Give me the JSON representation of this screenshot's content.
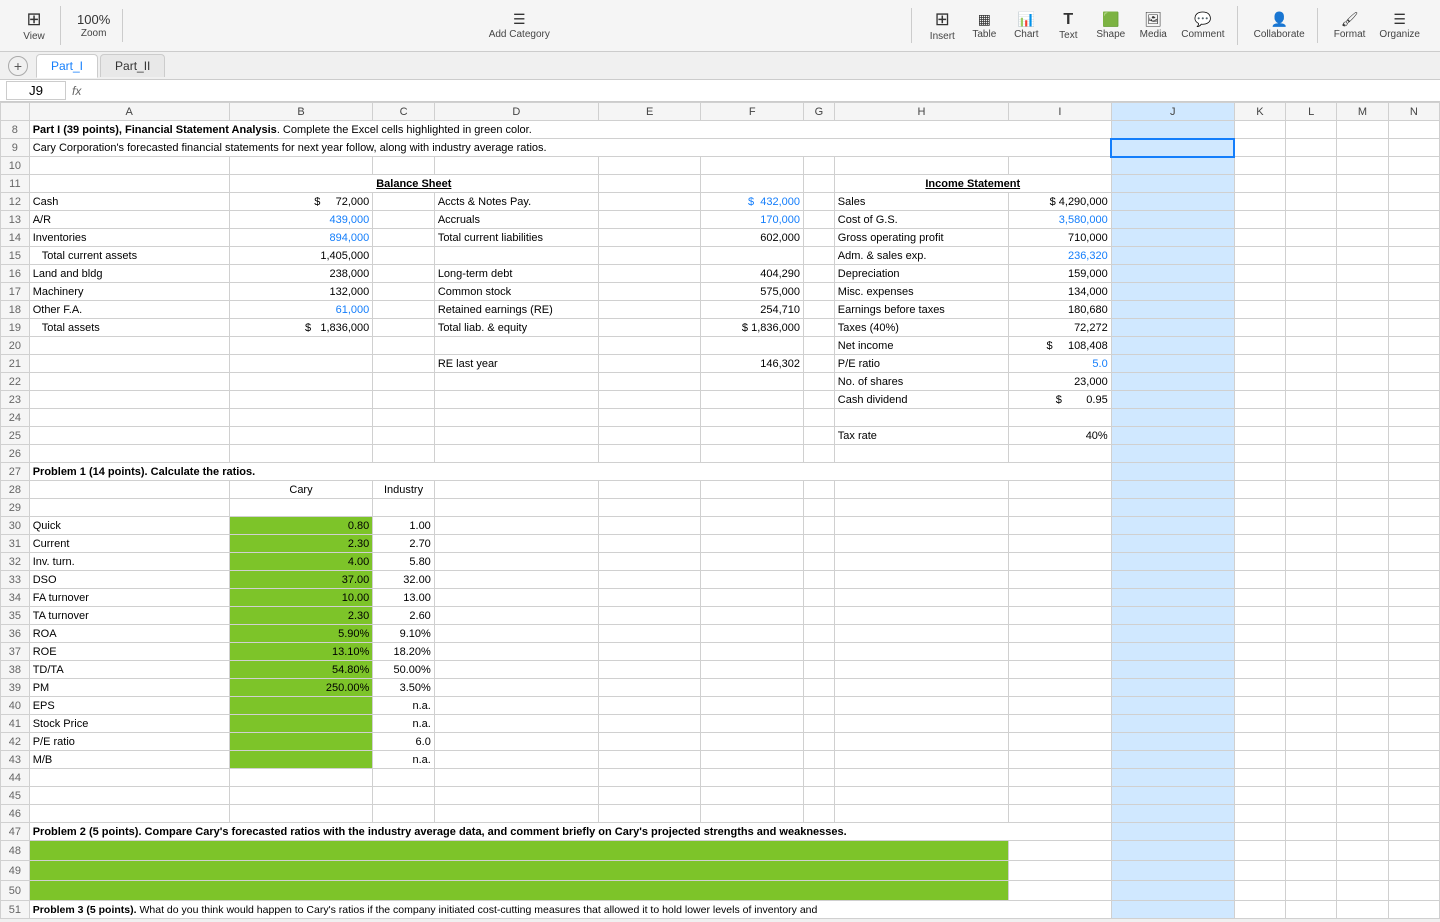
{
  "toolbar": {
    "view_label": "View",
    "zoom_label": "Zoom",
    "zoom_value": "100%",
    "add_category_label": "Add Category",
    "insert_label": "Insert",
    "table_label": "Table",
    "chart_label": "Chart",
    "text_label": "Text",
    "shape_label": "Shape",
    "media_label": "Media",
    "comment_label": "Comment",
    "collaborate_label": "Collaborate",
    "format_label": "Format",
    "organize_label": "Organize"
  },
  "tabs": {
    "add_label": "+",
    "part1_label": "Part_I",
    "part2_label": "Part_II"
  },
  "formula_bar": {
    "cell_ref": "J9",
    "fx": "fx"
  },
  "columns": [
    "",
    "A",
    "B",
    "C",
    "D",
    "E",
    "F",
    "G",
    "H",
    "I",
    "J",
    "K",
    "L",
    "M",
    "N"
  ],
  "rows": {
    "r8": {
      "a": "Part I (39 points), Financial Statement Analysis.  Complete the Excel cells highlighted in green color."
    },
    "r9": {
      "a": "Cary Corporation's forecasted financial statements for next year follow, along with industry average ratios."
    },
    "r11": {
      "b_center": "Balance Sheet",
      "h_center": "Income Statement"
    },
    "r12": {
      "a": "Cash",
      "b": "$       72,000",
      "d": "Accts & Notes Pay.",
      "f": "$   432,000",
      "h": "Sales",
      "i": "$ 4,290,000"
    },
    "r13": {
      "a": "A/R",
      "b_blue": "439,000",
      "d": "Accruals",
      "f_blue": "170,000",
      "h": "Cost of G.S.",
      "i_blue": "3,580,000"
    },
    "r14": {
      "a": "Inventories",
      "b_blue": "894,000",
      "d": "Total current liabilities",
      "f": "602,000",
      "h": "Gross operating profit",
      "i": "710,000"
    },
    "r15": {
      "a_indent": "Total current assets",
      "b": "1,405,000",
      "h": "Adm. & sales exp.",
      "i_blue": "236,320"
    },
    "r16": {
      "a": "Land and bldg",
      "b": "238,000",
      "d": "Long-term debt",
      "f": "404,290",
      "h": "Depreciation",
      "i": "159,000"
    },
    "r17": {
      "a": "Machinery",
      "b": "132,000",
      "d": "Common stock",
      "f": "575,000",
      "h": "Misc. expenses",
      "i": "134,000"
    },
    "r18": {
      "a": "Other F.A.",
      "b_blue": "61,000",
      "d": "Retained earnings (RE)",
      "f": "254,710",
      "h": "Earnings before taxes",
      "i": "180,680"
    },
    "r19": {
      "a_indent": "Total assets",
      "b_dollar": "$    1,836,000",
      "d": "Total liab. & equity",
      "f_dollar": "$ 1,836,000",
      "h": "Taxes (40%)",
      "i": "72,272"
    },
    "r20": {
      "h": "Net income",
      "i": "$     108,408"
    },
    "r21": {
      "d": "RE last year",
      "f": "146,302",
      "h": "P/E ratio",
      "i_blue": "5.0"
    },
    "r22": {
      "h": "No. of shares",
      "i": "23,000"
    },
    "r23": {
      "h": "Cash dividend",
      "i": "$         0.95"
    },
    "r25": {
      "h": "Tax rate",
      "i": "40%"
    },
    "r27": {
      "a": "Problem 1 (14 points). Calculate the ratios."
    },
    "r28": {
      "b_center": "Cary",
      "c_center": "Industry"
    },
    "r30": {
      "a": "Quick",
      "b_green": "0.80",
      "c": "1.00"
    },
    "r31": {
      "a": "Current",
      "b_green": "2.30",
      "c": "2.70"
    },
    "r32": {
      "a": "Inv. turn.",
      "b_green": "4.00",
      "c": "5.80"
    },
    "r33": {
      "a": "DSO",
      "b_green": "37.00",
      "c": "32.00"
    },
    "r34": {
      "a": "FA turnover",
      "b_green": "10.00",
      "c": "13.00"
    },
    "r35": {
      "a": "TA turnover",
      "b_green": "2.30",
      "c": "2.60"
    },
    "r36": {
      "a": "ROA",
      "b_green": "5.90%",
      "c": "9.10%"
    },
    "r37": {
      "a": "ROE",
      "b_green": "13.10%",
      "c": "18.20%"
    },
    "r38": {
      "a": "TD/TA",
      "b_green": "54.80%",
      "c": "50.00%"
    },
    "r39": {
      "a": "PM",
      "b_green": "250.00%",
      "c": "3.50%"
    },
    "r40": {
      "a": "EPS",
      "b_green": "",
      "c": "n.a."
    },
    "r41": {
      "a": "Stock Price",
      "b_green": "",
      "c": "n.a."
    },
    "r42": {
      "a": "P/E ratio",
      "b_green": "",
      "c": "6.0"
    },
    "r43": {
      "a": "M/B",
      "b_green": "",
      "c": "n.a."
    },
    "r47": {
      "a": "Problem 2 (5 points).  Compare Cary's forecasted ratios with the industry average data, and comment briefly on Cary's projected strengths and weaknesses."
    },
    "r51": {
      "a": "Problem 3 (5 points).  What do you think would happen to Cary's ratios if the company initiated cost-cutting measures that allowed it to hold lower levels of inventory and"
    }
  }
}
